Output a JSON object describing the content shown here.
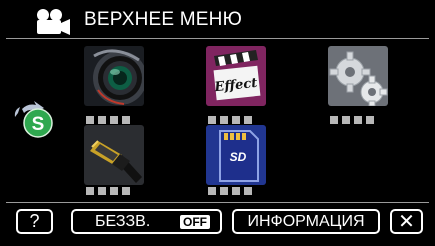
{
  "header": {
    "title": "ВЕРХНЕЕ МЕНЮ",
    "icon": "movie-camera-icon"
  },
  "menu": {
    "items": [
      {
        "icon": "camera-lens-icon",
        "dots": 4
      },
      {
        "icon": "effect-clapperboard-icon",
        "dots": 4,
        "effect_label": "Effect"
      },
      {
        "icon": "gears-icon",
        "dots": 4
      },
      {
        "icon": "hdmi-connector-icon",
        "dots": 4
      },
      {
        "icon": "sd-card-icon",
        "dots": 4,
        "card_label": "SD"
      }
    ],
    "side_button": {
      "icon": "s-cycle-icon",
      "label": "S"
    }
  },
  "bottom": {
    "help_label": "?",
    "mute_label": "БЕЗЗВ.",
    "mute_state": "OFF",
    "info_label": "ИНФОРМАЦИЯ",
    "close_label": "✕"
  },
  "colors": {
    "background": "#000000",
    "border": "#ffffff",
    "dot": "#b8b8b8",
    "s_button": "#2fa84f"
  }
}
